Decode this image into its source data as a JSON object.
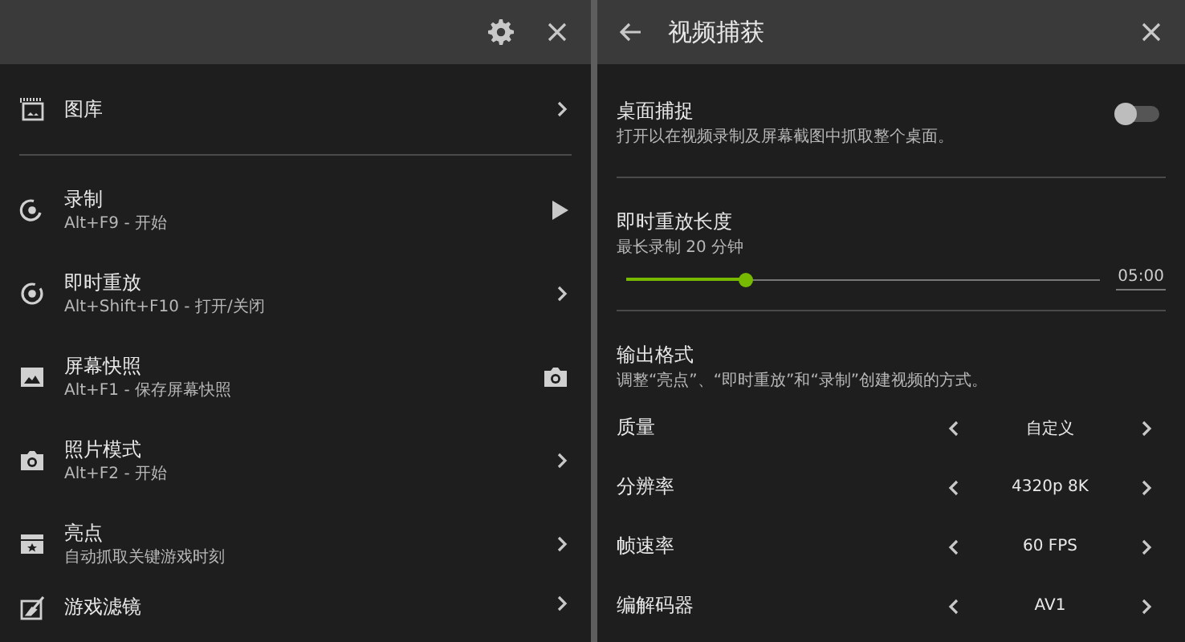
{
  "left_panel": {
    "items": [
      {
        "title": "图库"
      },
      {
        "title": "录制",
        "subtitle": "Alt+F9 - 开始"
      },
      {
        "title": "即时重放",
        "subtitle": "Alt+Shift+F10 - 打开/关闭"
      },
      {
        "title": "屏幕快照",
        "subtitle": "Alt+F1 - 保存屏幕快照"
      },
      {
        "title": "照片模式",
        "subtitle": "Alt+F2 - 开始"
      },
      {
        "title": "亮点",
        "subtitle": "自动抓取关键游戏时刻"
      },
      {
        "title": "游戏滤镜"
      }
    ]
  },
  "right_panel": {
    "title": "视频捕获",
    "desktop_capture": {
      "title": "桌面捕捉",
      "subtitle": "打开以在视频录制及屏幕截图中抓取整个桌面。",
      "on": false
    },
    "replay_length": {
      "title": "即时重放长度",
      "subtitle": "最长录制 20 分钟",
      "level": 0.25,
      "reading": "05:00"
    },
    "output_format": {
      "title": "输出格式",
      "subtitle": "调整“亮点”、“即时重放”和“录制”创建视频的方式。",
      "settings": [
        {
          "label": "质量",
          "value": "自定义"
        },
        {
          "label": "分辨率",
          "value": "4320p 8K"
        },
        {
          "label": "帧速率",
          "value": "60 FPS"
        },
        {
          "label": "编解码器",
          "value": "AV1"
        }
      ]
    }
  }
}
